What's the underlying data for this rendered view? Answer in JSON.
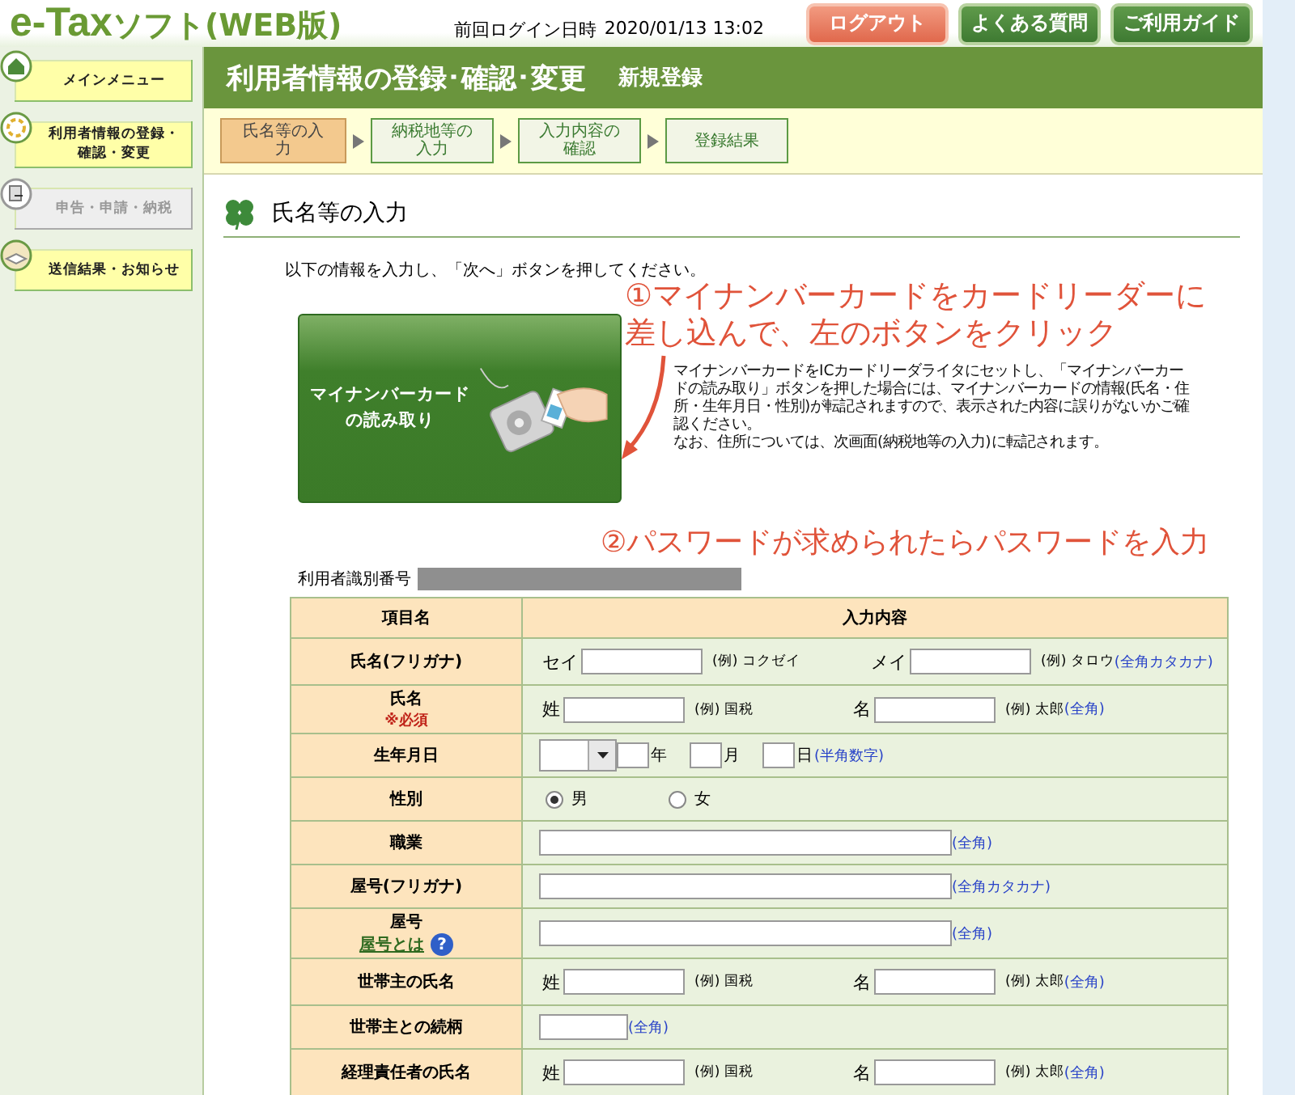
{
  "header": {
    "logo_main": "e-Tax",
    "logo_sub": "ソフト(WEB版)",
    "last_login_label": "前回ログイン日時",
    "last_login_time": "2020/01/13 13:02",
    "buttons": [
      {
        "label": "ログアウト",
        "kind": "logout"
      },
      {
        "label": "よくある質問",
        "kind": "link"
      },
      {
        "label": "ご利用ガイド",
        "kind": "link"
      }
    ]
  },
  "sidebar": {
    "items": [
      {
        "label": "メインメニュー",
        "kind": "home",
        "disabled": false
      },
      {
        "label": "利用者情報の登録・確認・変更",
        "kind": "user",
        "disabled": false
      },
      {
        "label": "申告・申請・納税",
        "kind": "document",
        "disabled": true
      },
      {
        "label": "送信結果・お知らせ",
        "kind": "mail",
        "disabled": false
      }
    ]
  },
  "page_title": "利用者情報の登録･確認･変更",
  "page_subtitle": "新規登録",
  "steps": [
    {
      "label": "氏名等の入力",
      "selected": true
    },
    {
      "label": "納税地等の入力",
      "selected": false
    },
    {
      "label": "入力内容の確認",
      "selected": false
    },
    {
      "label": "登録結果",
      "selected": false
    }
  ],
  "section_title": "氏名等の入力",
  "intro": "以下の情報を入力し、「次へ」ボタンを押してください。",
  "card_button": "マイナンバーカードの読み取り",
  "note": [
    "マイナンバーカードをICカードリーダライタにセットし、「マイナンバーカードの読み取り」ボタンを押した場合には、マイナンバーカードの情報(氏名・住所・生年月日・性別)が転記されますので、表示された内容に誤りがないかご確認ください。",
    "なお、住所については、次画面(納税地等の入力)に転記されます。"
  ],
  "annotations": [
    "①マイナンバーカードをカードリーダーに差し込んで、左のボタンをクリック",
    "②パスワードが求められたらパスワードを入力"
  ],
  "id_label": "利用者識別番号",
  "table": {
    "columns": [
      "項目名",
      "入力内容"
    ],
    "rows": [
      {
        "label": "氏名(フリガナ)",
        "kind": "pair",
        "fields": [
          {
            "prefix": "セイ",
            "example": "(例) コクゼイ"
          },
          {
            "prefix": "メイ",
            "example": "(例) タロウ"
          }
        ],
        "hint": "(全角カタカナ)"
      },
      {
        "label": "氏名",
        "required": "※必須",
        "kind": "pair",
        "fields": [
          {
            "prefix": "姓",
            "example": "(例) 国税"
          },
          {
            "prefix": "名",
            "example": "(例) 太郎"
          }
        ],
        "hint": "(全角)"
      },
      {
        "label": "生年月日",
        "kind": "date",
        "units": [
          "年",
          "月",
          "日"
        ],
        "format_hint": "(半角数字)"
      },
      {
        "label": "性別",
        "kind": "radio",
        "options": [
          {
            "label": "男",
            "selected": true
          },
          {
            "label": "女",
            "selected": false
          }
        ]
      },
      {
        "label": "職業",
        "kind": "wide",
        "hint": "(全角)"
      },
      {
        "label": "屋号(フリガナ)",
        "kind": "wide",
        "hint": "(全角カタカナ)"
      },
      {
        "label": "屋号",
        "link": "屋号とは",
        "help_mark": "?",
        "kind": "wide",
        "hint": "(全角)"
      },
      {
        "label": "世帯主の氏名",
        "kind": "pair",
        "fields": [
          {
            "prefix": "姓",
            "example": "(例) 国税"
          },
          {
            "prefix": "名",
            "example": "(例) 太郎"
          }
        ],
        "hint": "(全角)"
      },
      {
        "label": "世帯主との続柄",
        "kind": "short",
        "short_hint": "(全角)"
      },
      {
        "label": "経理責任者の氏名",
        "kind": "pair",
        "fields": [
          {
            "prefix": "姓",
            "example": "(例) 国税"
          },
          {
            "prefix": "名",
            "example": "(例) 太郎"
          }
        ],
        "hint": "(全角)"
      }
    ]
  }
}
